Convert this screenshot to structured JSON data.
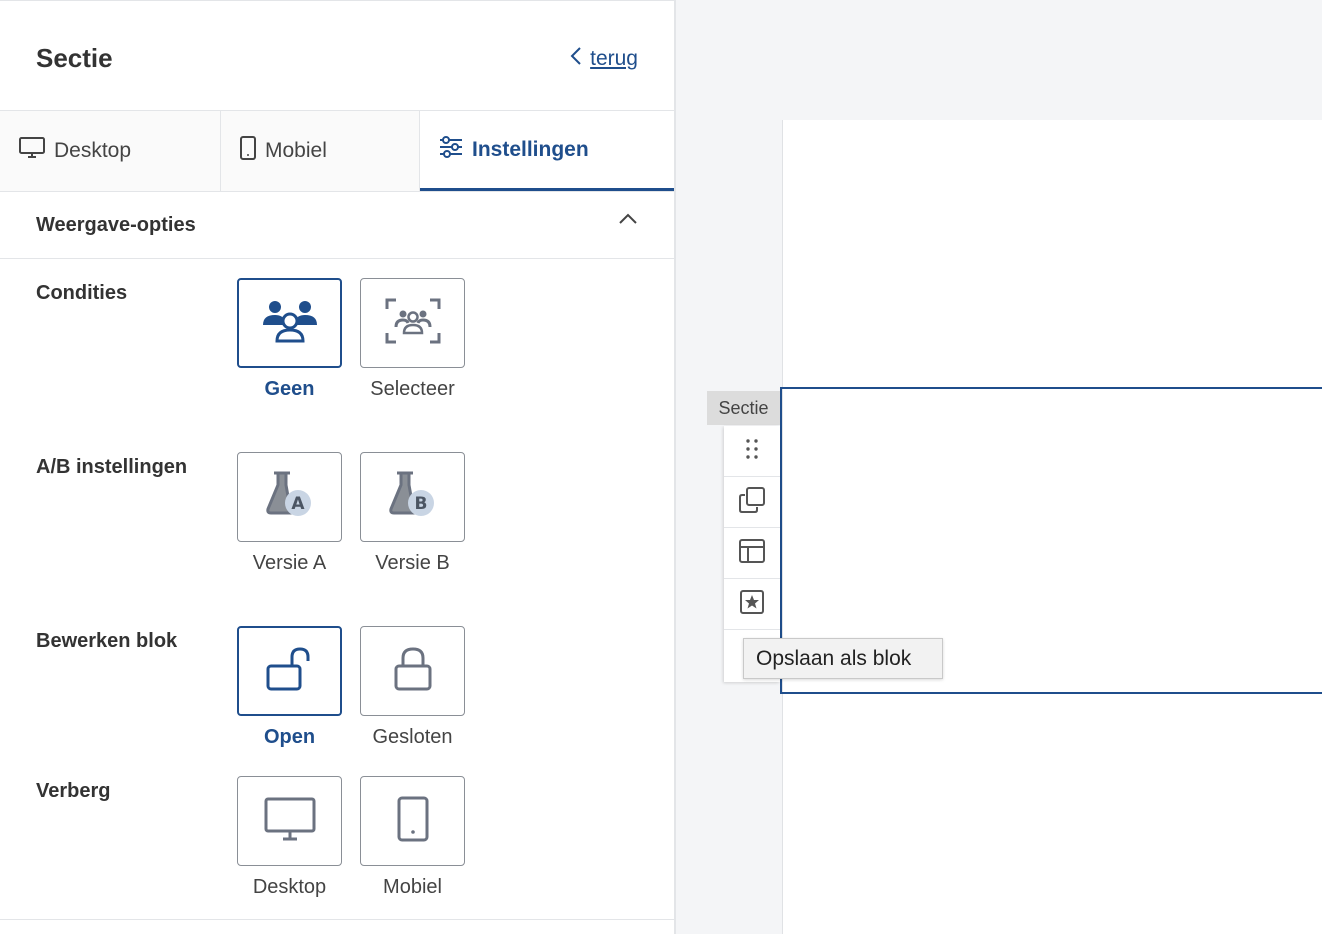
{
  "panel": {
    "title": "Sectie",
    "back_label": "terug"
  },
  "tabs": [
    {
      "label": "Desktop",
      "icon": "desktop-icon"
    },
    {
      "label": "Mobiel",
      "icon": "mobile-icon"
    },
    {
      "label": "Instellingen",
      "icon": "sliders-icon",
      "active": true
    }
  ],
  "section": {
    "title": "Weergave-opties",
    "expanded": true
  },
  "rows": [
    {
      "label": "Condities",
      "options": [
        {
          "label": "Geen",
          "icon": "users-icon",
          "active": true
        },
        {
          "label": "Selecteer",
          "icon": "users-scan-icon",
          "active": false
        }
      ]
    },
    {
      "label": "A/B instellingen",
      "options": [
        {
          "label": "Versie A",
          "icon": "flask-a-icon",
          "active": false
        },
        {
          "label": "Versie B",
          "icon": "flask-b-icon",
          "active": false
        }
      ]
    },
    {
      "label": "Bewerken blok",
      "options": [
        {
          "label": "Open",
          "icon": "unlock-icon",
          "active": true
        },
        {
          "label": "Gesloten",
          "icon": "lock-icon",
          "active": false
        }
      ]
    },
    {
      "label": "Verberg",
      "options": [
        {
          "label": "Desktop",
          "icon": "desktop-icon",
          "active": false
        },
        {
          "label": "Mobiel",
          "icon": "mobile-icon",
          "active": false
        }
      ]
    }
  ],
  "canvas": {
    "section_tag": "Sectie",
    "tooltip": "Opslaan als blok",
    "tools": [
      "drag-handle-icon",
      "duplicate-icon",
      "layout-icon",
      "save-block-icon",
      "delete-icon"
    ]
  },
  "colors": {
    "accent": "#1f4e8c",
    "border": "#8a8f96",
    "icon_gray": "#6b7280"
  }
}
